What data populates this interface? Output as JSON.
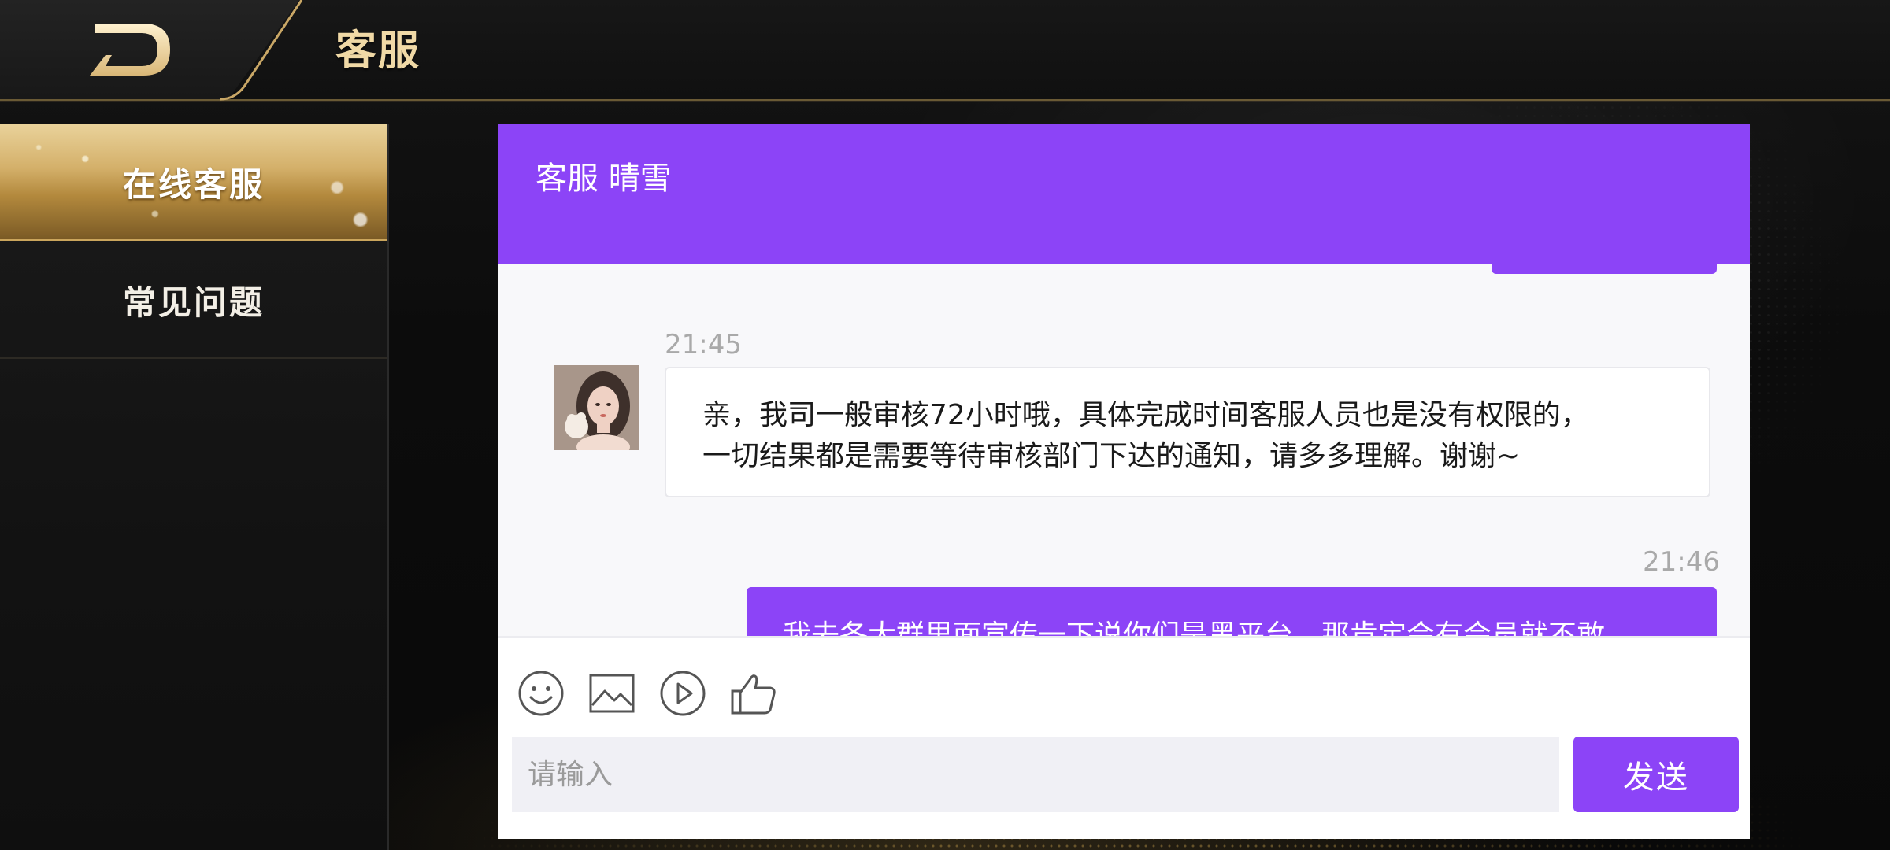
{
  "header": {
    "title": "客服",
    "logo_icon": "brand-logo-icon"
  },
  "sidebar": {
    "items": [
      {
        "label": "在线客服",
        "active": true
      },
      {
        "label": "常见问题",
        "active": false
      }
    ]
  },
  "chat": {
    "title": "客服 晴雪",
    "messages": [
      {
        "time": "21:45",
        "from": "agent",
        "text": "亲，我司一般审核72小时哦，具体完成时间客服人员也是没有权限的，\n一切结果都是需要等待审核部门下达的通知，请多多理解。谢谢~"
      },
      {
        "time": "21:46",
        "from": "user",
        "text": "我去各大群里面宣传一下说你们是黑平台，那肯定会有会员就不敢"
      }
    ]
  },
  "composer": {
    "tools": [
      "smile-icon",
      "image-icon",
      "play-circle-icon",
      "thumbs-up-icon"
    ],
    "placeholder": "请输入",
    "send_label": "发送"
  },
  "colors": {
    "accent": "#8c44f7",
    "gold": "#d4b06a",
    "title_gold": "#f0d9a6"
  }
}
